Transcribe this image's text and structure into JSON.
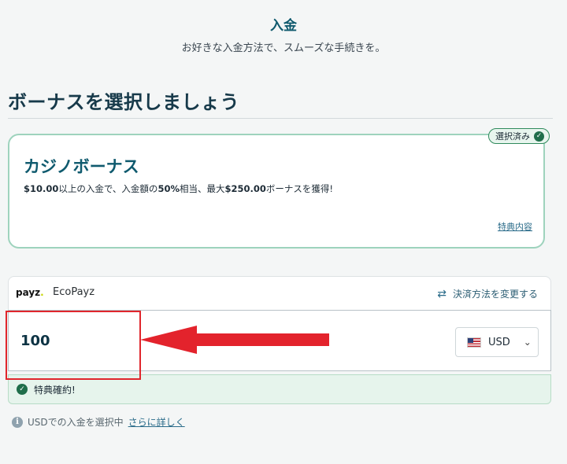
{
  "header": {
    "title": "入金",
    "subtitle": "お好きな入金方法で、スムーズな手続きを。"
  },
  "bonus_section": {
    "title": "ボーナスを選択しましょう",
    "card": {
      "badge_label": "選択済み",
      "name": "カジノボーナス",
      "desc_part1": "$10.00",
      "desc_part2": "以上の入金で、入金額の",
      "desc_part3": "50%",
      "desc_part4": "相当、最大",
      "desc_part5": "$250.00",
      "desc_part6": "ボーナスを獲得!",
      "details_link": "特典内容"
    }
  },
  "payment": {
    "logo_text": "payz",
    "logo_dot": ".",
    "method_name": "EcoPayz",
    "change_label": "決済方法を変更する",
    "amount": "100",
    "currency": "USD",
    "confirm_label": "特典確約!"
  },
  "info": {
    "text": "USDでの入金を選択中",
    "link": "さらに詳しく"
  },
  "icons": {
    "check": "check-icon",
    "swap": "swap-arrows-icon",
    "flag": "us-flag-icon",
    "chevron": "chevron-down-icon",
    "info": "info-icon"
  },
  "colors": {
    "accent": "#0f5a6e",
    "success": "#1f6e4a",
    "annotation": "#e3232c"
  }
}
